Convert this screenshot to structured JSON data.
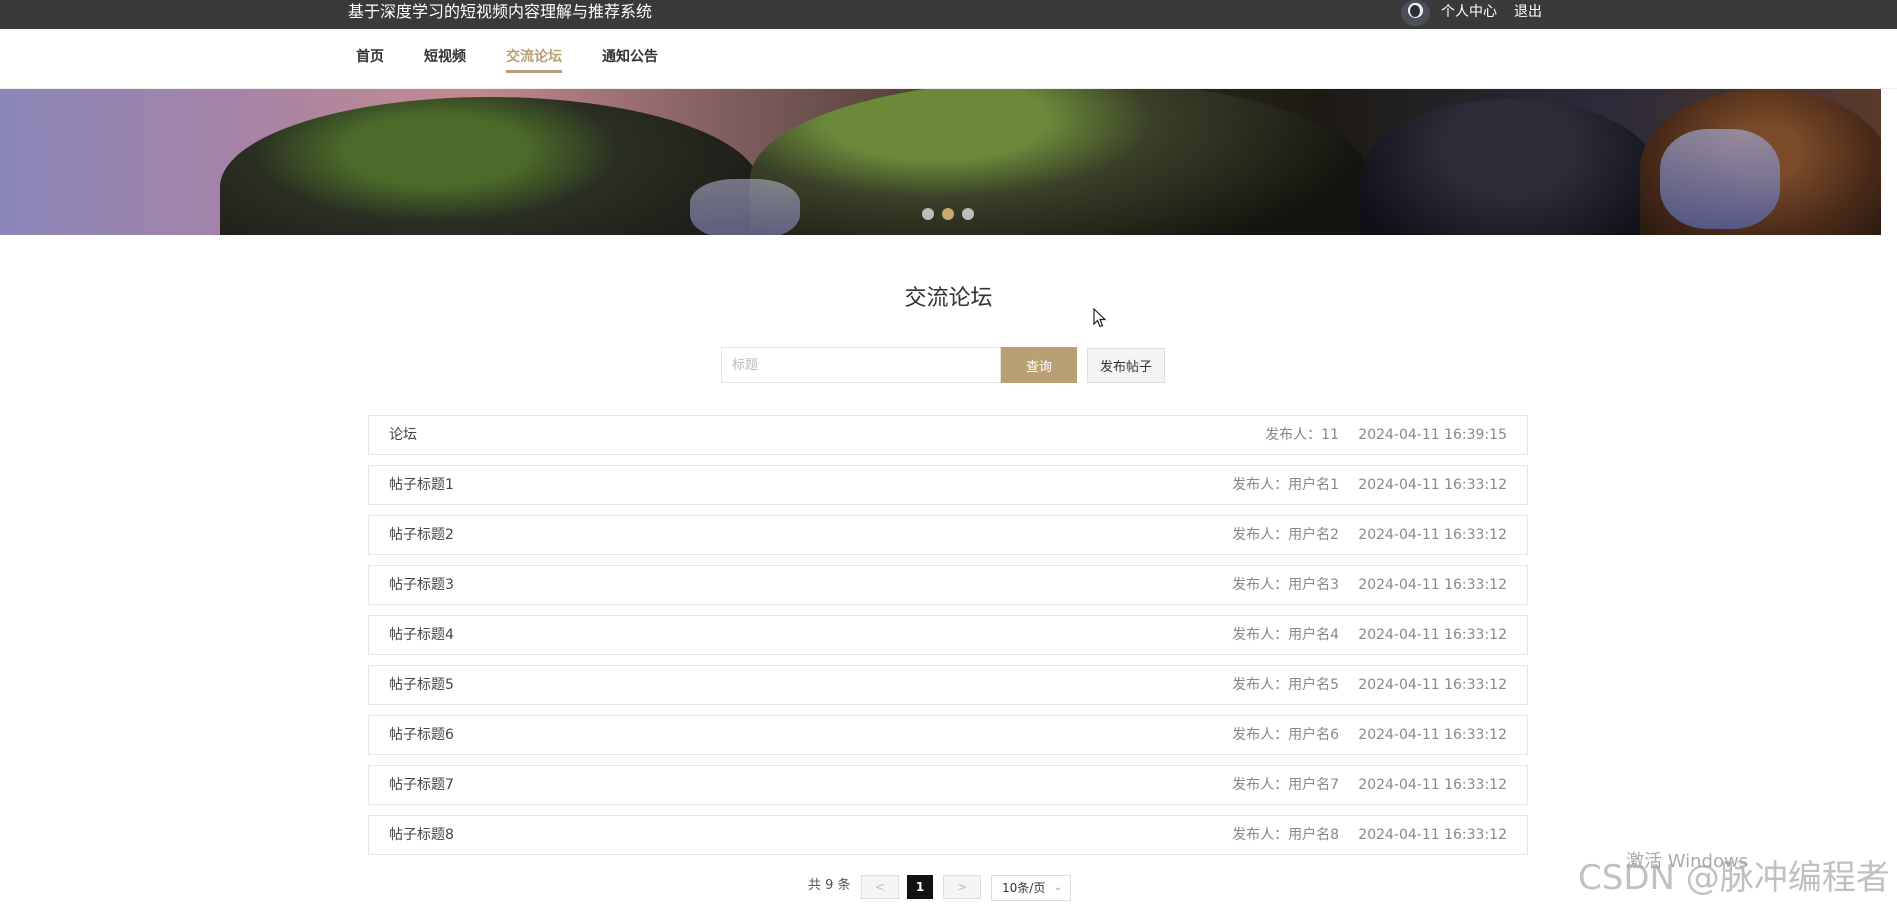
{
  "header": {
    "site_title": "基于深度学习的短视频内容理解与推荐系统",
    "profile_label": "个人中心",
    "logout_label": "退出"
  },
  "nav": {
    "items": [
      {
        "label": "首页",
        "active": false
      },
      {
        "label": "短视频",
        "active": false
      },
      {
        "label": "交流论坛",
        "active": true
      },
      {
        "label": "通知公告",
        "active": false
      }
    ]
  },
  "banner": {
    "dots": 3,
    "active_dot": 2
  },
  "main": {
    "heading": "交流论坛",
    "search_placeholder": "标题",
    "query_label": "查询",
    "post_label": "发布帖子"
  },
  "posts": [
    {
      "title": "论坛",
      "author": "发布人：11",
      "time": "2024-04-11 16:39:15"
    },
    {
      "title": "帖子标题1",
      "author": "发布人：用户名1",
      "time": "2024-04-11 16:33:12"
    },
    {
      "title": "帖子标题2",
      "author": "发布人：用户名2",
      "time": "2024-04-11 16:33:12"
    },
    {
      "title": "帖子标题3",
      "author": "发布人：用户名3",
      "time": "2024-04-11 16:33:12"
    },
    {
      "title": "帖子标题4",
      "author": "发布人：用户名4",
      "time": "2024-04-11 16:33:12"
    },
    {
      "title": "帖子标题5",
      "author": "发布人：用户名5",
      "time": "2024-04-11 16:33:12"
    },
    {
      "title": "帖子标题6",
      "author": "发布人：用户名6",
      "time": "2024-04-11 16:33:12"
    },
    {
      "title": "帖子标题7",
      "author": "发布人：用户名7",
      "time": "2024-04-11 16:33:12"
    },
    {
      "title": "帖子标题8",
      "author": "发布人：用户名8",
      "time": "2024-04-11 16:33:12"
    }
  ],
  "pagination": {
    "total_label": "共 9 条",
    "prev": "<",
    "current_page": "1",
    "next": ">",
    "page_size": "10条/页"
  },
  "overlay": {
    "windows_watermark": "激活 Windows",
    "csdn_watermark": "CSDN @脉冲编程者"
  },
  "colors": {
    "accent": "#b9a074",
    "topbar": "#3a3a3a"
  }
}
